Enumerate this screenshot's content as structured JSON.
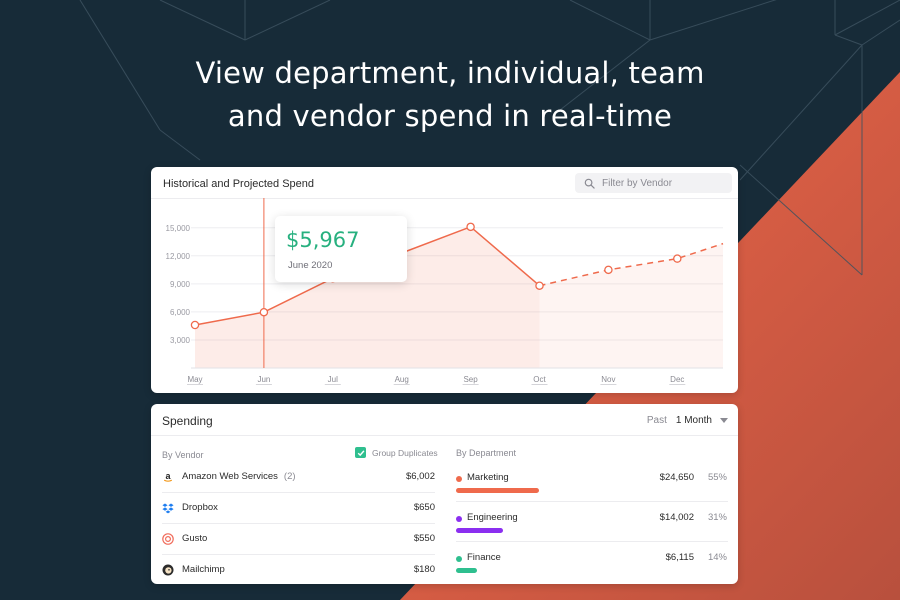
{
  "headline": {
    "line1": "View department, individual, team",
    "line2": "and vendor spend in real-time"
  },
  "colors": {
    "background": "#172b38",
    "accent_orange": "#ef6a4c",
    "green": "#27b07f",
    "purple": "#8b2ff0"
  },
  "chart_panel": {
    "title": "Historical and Projected Spend",
    "filter_placeholder": "Filter by Vendor",
    "tooltip_amount": "$5,967",
    "tooltip_date": "June 2020"
  },
  "chart_data": {
    "type": "area",
    "title": "Historical and Projected Spend",
    "categories": [
      "May",
      "Jun",
      "Jul",
      "Aug",
      "Sep",
      "Oct",
      "Nov",
      "Dec"
    ],
    "y_ticks": [
      "15,000",
      "12,000",
      "9,000",
      "6,000",
      "3,000"
    ],
    "ylim": [
      0,
      16500
    ],
    "series": [
      {
        "name": "historical",
        "style": "solid",
        "x": [
          "May",
          "Jun",
          "Jul",
          "Aug",
          "Sep",
          "Oct"
        ],
        "values": [
          4600,
          5967,
          9600,
          12300,
          15100,
          8800
        ]
      },
      {
        "name": "projected",
        "style": "dashed",
        "x": [
          "Oct",
          "Nov",
          "Dec",
          "end"
        ],
        "values": [
          8800,
          10500,
          11700,
          13300
        ]
      }
    ],
    "marker_x": "Jun",
    "grid": true
  },
  "spending": {
    "title": "Spending",
    "period_label": "Past",
    "period_value": "1 Month",
    "by_vendor_label": "By Vendor",
    "group_duplicates_label": "Group Duplicates",
    "vendors": [
      {
        "name": "Amazon Web Services",
        "count": "(2)",
        "amount": "$6,002",
        "icon": "amazon-icon"
      },
      {
        "name": "Dropbox",
        "count": "",
        "amount": "$650",
        "icon": "dropbox-icon"
      },
      {
        "name": "Gusto",
        "count": "",
        "amount": "$550",
        "icon": "gusto-icon"
      },
      {
        "name": "Mailchimp",
        "count": "",
        "amount": "$180",
        "icon": "mailchimp-icon"
      }
    ],
    "by_department_label": "By Department",
    "departments": [
      {
        "name": "Marketing",
        "amount": "$24,650",
        "percent": "55%",
        "share": 0.55,
        "color": "#ef6a4c"
      },
      {
        "name": "Engineering",
        "amount": "$14,002",
        "percent": "31%",
        "share": 0.31,
        "color": "#8b2ff0"
      },
      {
        "name": "Finance",
        "amount": "$6,115",
        "percent": "14%",
        "share": 0.14,
        "color": "#2fbf8f"
      }
    ]
  }
}
